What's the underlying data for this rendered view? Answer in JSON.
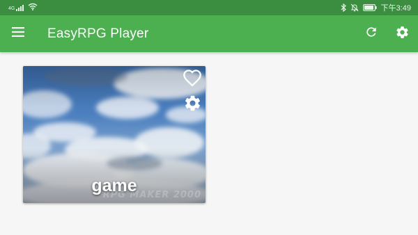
{
  "status_bar": {
    "signal_text": "4G",
    "time": "下午3:49",
    "icons": [
      "signal-icon",
      "wifi-icon",
      "bluetooth-icon",
      "mute-icon",
      "battery-icon"
    ],
    "background": "#3b8e3f"
  },
  "app_bar": {
    "title": "EasyRPG Player",
    "background": "#4caf50",
    "menu_icon": "menu-icon",
    "refresh_icon": "refresh-icon",
    "settings_icon": "gear-icon"
  },
  "games": [
    {
      "title": "game",
      "watermark": "RPG MAKER 2000",
      "favorite_icon": "heart-outline-icon",
      "settings_icon": "gear-icon"
    }
  ]
}
